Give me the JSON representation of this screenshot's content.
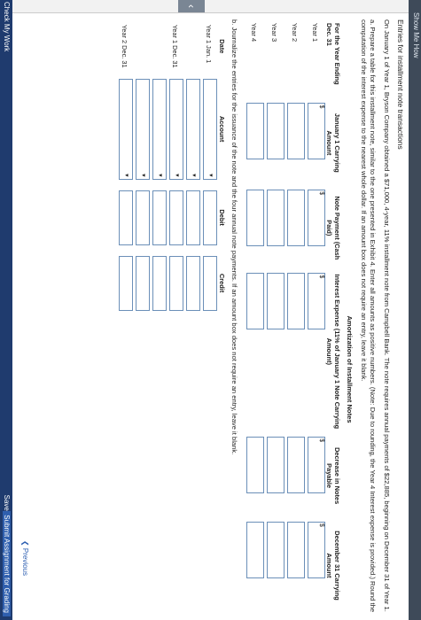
{
  "top": {
    "show_label": "Show Me How"
  },
  "bottom": {
    "check_label": "Check My Work",
    "save_label": "Save and Exit",
    "submit_label": "Submit Assignment for Grading"
  },
  "nav": {
    "prev_label": "Previous"
  },
  "content": {
    "title": "Entries for installment note transactions",
    "intro": "On January 1 of Year 1, Bryson Company obtained a $71,000, 4-year, 11% installment note from Campbell Bank. The note requires annual payments of $22,885, beginning on December 31 of Year 1.",
    "part_a": "a. Prepare a table for this installment note, similar to the one presented in Exhibit 4. Enter all amounts as positive numbers. (Note: Due to rounding, the Year 4 Interest expense is provided.) Round the computation of the interest expense to the nearest whole dollar. If an amount box does not require an entry, leave it blank.",
    "amort_title": "Amortization of Installment Notes",
    "headers": [
      "For the Year Ending Dec. 31",
      "January 1 Carrying Amount",
      "Note Payment (Cash Paid)",
      "Interest Expense (11% of January 1 Note Carrying Amount)",
      "Decrease in Notes Payable",
      "December 31 Carrying Amount"
    ],
    "years": [
      "Year 1",
      "Year 2",
      "Year 3",
      "Year 4"
    ],
    "part_b": "b. Journalize the entries for the issuance of the note and the four annual note payments. If an amount box does not require an entry, leave it blank.",
    "journal_headers": [
      "Date",
      "Account",
      "Debit",
      "Credit"
    ],
    "journal_dates": [
      "Year 1 Jan. 1",
      "Year 1 Dec. 31",
      "Year 2 Dec. 31"
    ]
  }
}
